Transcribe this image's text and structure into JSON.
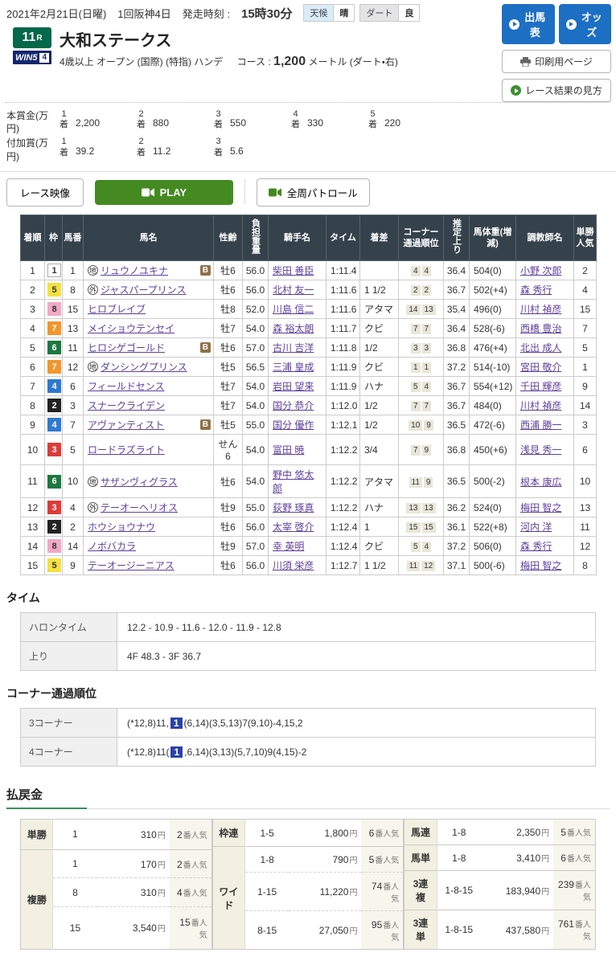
{
  "colors": {
    "button_blue": "#1d6fc4",
    "play_green": "#448a21",
    "race_badge_green": "#04684a",
    "win5_navy": "#13266e",
    "table_header": "#35424b",
    "link_purple": "#5f3e9c",
    "highlight_blue": "#2c41a7",
    "payout_green_bar": "#3a9058",
    "frames": {
      "1": {
        "bg": "#ffffff",
        "fg": "#333333",
        "bd": "#aaaaaa"
      },
      "2": {
        "bg": "#222222",
        "fg": "#ffffff"
      },
      "3": {
        "bg": "#dd3b3b",
        "fg": "#ffffff"
      },
      "4": {
        "bg": "#2e79cf",
        "fg": "#ffffff"
      },
      "5": {
        "bg": "#f2e140",
        "fg": "#333333"
      },
      "6": {
        "bg": "#1c7841",
        "fg": "#ffffff"
      },
      "7": {
        "bg": "#f1962c",
        "fg": "#ffffff"
      },
      "8": {
        "bg": "#f0a9c2",
        "fg": "#333333"
      }
    }
  },
  "topbar": {
    "date": "2021年2月21日(日曜)",
    "meeting": "1回阪神4日",
    "start_label": "発走時刻 :",
    "start_time": "15時30分",
    "weather_label": "天候",
    "weather_value": "晴",
    "track_label": "ダート",
    "track_condition": "良",
    "entry_button": "出馬表",
    "odds_button": "オッズ",
    "print_button": "印刷用ページ",
    "guide_button": "レース結果の見方"
  },
  "race": {
    "number": "11",
    "number_unit": "R",
    "win5_label": "WIN5",
    "win5_number": "4",
    "title": "大和ステークス",
    "conditions": "4歳以上 オープン (国際) (特指) ハンデ",
    "course_label": "コース :",
    "course_distance": "1,200",
    "course_detail": "メートル (ダート・右)"
  },
  "prize": {
    "main_label": "本賞金(万円)",
    "bonus_label": "付加賞(万円)",
    "rank_suffix": "着",
    "main": [
      {
        "rank": "1",
        "amount": "2,200"
      },
      {
        "rank": "2",
        "amount": "880"
      },
      {
        "rank": "3",
        "amount": "550"
      },
      {
        "rank": "4",
        "amount": "330"
      },
      {
        "rank": "5",
        "amount": "220"
      }
    ],
    "bonus": [
      {
        "rank": "1",
        "amount": "39.2"
      },
      {
        "rank": "2",
        "amount": "11.2"
      },
      {
        "rank": "3",
        "amount": "5.6"
      }
    ]
  },
  "video": {
    "race_video": "レース映像",
    "play": "PLAY",
    "patrol": "全周パトロール"
  },
  "results": {
    "blinker_label": "B",
    "columns": [
      "着順",
      "枠",
      "馬番",
      "馬名",
      "性齢",
      "負担重量",
      "騎手名",
      "タイム",
      "着差",
      "コーナー通過順位",
      "推定上り",
      "馬体重(増減)",
      "調教師名",
      "単勝人気"
    ],
    "rows": [
      {
        "pos": "1",
        "frame": "1",
        "num": "1",
        "mark": "地",
        "blinker": true,
        "name": "リュウノユキナ",
        "sex_age": "牡6",
        "impost": "56.0",
        "jockey": "柴田 善臣",
        "time": "1:11.4",
        "margin": "",
        "corners": [
          "4",
          "4"
        ],
        "last3f": "36.4",
        "weight": "504(0)",
        "trainer": "小野 次郎",
        "pop": "2"
      },
      {
        "pos": "2",
        "frame": "5",
        "num": "8",
        "mark": "外",
        "blinker": false,
        "name": "ジャスパープリンス",
        "sex_age": "牡6",
        "impost": "56.0",
        "jockey": "北村 友一",
        "time": "1:11.6",
        "margin": "1 1/2",
        "corners": [
          "2",
          "2"
        ],
        "last3f": "36.7",
        "weight": "502(+4)",
        "trainer": "森 秀行",
        "pop": "4"
      },
      {
        "pos": "3",
        "frame": "8",
        "num": "15",
        "mark": "",
        "blinker": false,
        "name": "ヒロブレイブ",
        "sex_age": "牡8",
        "impost": "52.0",
        "jockey": "川島 信二",
        "time": "1:11.6",
        "margin": "アタマ",
        "corners": [
          "14",
          "13"
        ],
        "last3f": "35.4",
        "weight": "496(0)",
        "trainer": "川村 禎彦",
        "pop": "15"
      },
      {
        "pos": "4",
        "frame": "7",
        "num": "13",
        "mark": "",
        "blinker": false,
        "name": "メイショウテンセイ",
        "sex_age": "牡7",
        "impost": "54.0",
        "jockey": "森 裕太朗",
        "time": "1:11.7",
        "margin": "クビ",
        "corners": [
          "7",
          "7"
        ],
        "last3f": "36.4",
        "weight": "528(-6)",
        "trainer": "西橋 豊治",
        "pop": "7"
      },
      {
        "pos": "5",
        "frame": "6",
        "num": "11",
        "mark": "",
        "blinker": true,
        "name": "ヒロシゲゴールド",
        "sex_age": "牡6",
        "impost": "57.0",
        "jockey": "古川 吉洋",
        "time": "1:11.8",
        "margin": "1/2",
        "corners": [
          "3",
          "3"
        ],
        "last3f": "36.8",
        "weight": "476(+4)",
        "trainer": "北出 成人",
        "pop": "5"
      },
      {
        "pos": "6",
        "frame": "7",
        "num": "12",
        "mark": "地",
        "blinker": false,
        "name": "ダンシングプリンス",
        "sex_age": "牡5",
        "impost": "56.5",
        "jockey": "三浦 皇成",
        "time": "1:11.9",
        "margin": "クビ",
        "corners": [
          "1",
          "1"
        ],
        "last3f": "37.2",
        "weight": "514(-10)",
        "trainer": "宮田 敬介",
        "pop": "1"
      },
      {
        "pos": "7",
        "frame": "4",
        "num": "6",
        "mark": "",
        "blinker": false,
        "name": "フィールドセンス",
        "sex_age": "牡7",
        "impost": "54.0",
        "jockey": "岩田 望来",
        "time": "1:11.9",
        "margin": "ハナ",
        "corners": [
          "5",
          "4"
        ],
        "last3f": "36.7",
        "weight": "554(+12)",
        "trainer": "千田 輝彦",
        "pop": "9"
      },
      {
        "pos": "8",
        "frame": "2",
        "num": "3",
        "mark": "",
        "blinker": false,
        "name": "スナークライデン",
        "sex_age": "牡7",
        "impost": "54.0",
        "jockey": "国分 恭介",
        "time": "1:12.0",
        "margin": "1/2",
        "corners": [
          "7",
          "7"
        ],
        "last3f": "36.7",
        "weight": "484(0)",
        "trainer": "川村 禎彦",
        "pop": "14"
      },
      {
        "pos": "9",
        "frame": "4",
        "num": "7",
        "mark": "",
        "blinker": true,
        "name": "アヴァンティスト",
        "sex_age": "牡5",
        "impost": "55.0",
        "jockey": "国分 優作",
        "time": "1:12.1",
        "margin": "1/2",
        "corners": [
          "10",
          "9"
        ],
        "last3f": "36.5",
        "weight": "472(-6)",
        "trainer": "西浦 勝一",
        "pop": "3"
      },
      {
        "pos": "10",
        "frame": "3",
        "num": "5",
        "mark": "",
        "blinker": false,
        "name": "ロードラズライト",
        "sex_age": "せん6",
        "impost": "54.0",
        "jockey": "富田 暁",
        "time": "1:12.2",
        "margin": "3/4",
        "corners": [
          "7",
          "9"
        ],
        "last3f": "36.8",
        "weight": "450(+6)",
        "trainer": "浅見 秀一",
        "pop": "6"
      },
      {
        "pos": "11",
        "frame": "6",
        "num": "10",
        "mark": "地",
        "blinker": false,
        "name": "サザンヴィグラス",
        "sex_age": "牡6",
        "impost": "54.0",
        "jockey": "野中 悠太郎",
        "time": "1:12.2",
        "margin": "アタマ",
        "corners": [
          "11",
          "9"
        ],
        "last3f": "36.5",
        "weight": "500(-2)",
        "trainer": "根本 康広",
        "pop": "10"
      },
      {
        "pos": "12",
        "frame": "3",
        "num": "4",
        "mark": "外",
        "blinker": false,
        "name": "テーオーヘリオス",
        "sex_age": "牡9",
        "impost": "55.0",
        "jockey": "荻野 琢真",
        "time": "1:12.2",
        "margin": "ハナ",
        "corners": [
          "13",
          "13"
        ],
        "last3f": "36.2",
        "weight": "524(0)",
        "trainer": "梅田 智之",
        "pop": "13"
      },
      {
        "pos": "13",
        "frame": "2",
        "num": "2",
        "mark": "",
        "blinker": false,
        "name": "ホウショウナウ",
        "sex_age": "牡6",
        "impost": "56.0",
        "jockey": "太宰 啓介",
        "time": "1:12.4",
        "margin": "1",
        "corners": [
          "15",
          "15"
        ],
        "last3f": "36.1",
        "weight": "522(+8)",
        "trainer": "河内 洋",
        "pop": "11"
      },
      {
        "pos": "14",
        "frame": "8",
        "num": "14",
        "mark": "",
        "blinker": false,
        "name": "ノボバカラ",
        "sex_age": "牡9",
        "impost": "57.0",
        "jockey": "幸 英明",
        "time": "1:12.4",
        "margin": "クビ",
        "corners": [
          "5",
          "4"
        ],
        "last3f": "37.2",
        "weight": "506(0)",
        "trainer": "森 秀行",
        "pop": "12"
      },
      {
        "pos": "15",
        "frame": "5",
        "num": "9",
        "mark": "",
        "blinker": false,
        "name": "テーオージーニアス",
        "sex_age": "牡6",
        "impost": "56.0",
        "jockey": "川須 栄彦",
        "time": "1:12.7",
        "margin": "1 1/2",
        "corners": [
          "11",
          "12"
        ],
        "last3f": "37.1",
        "weight": "500(-6)",
        "trainer": "梅田 智之",
        "pop": "8"
      }
    ]
  },
  "time_section": {
    "title": "タイム",
    "rows": [
      {
        "label": "ハロンタイム",
        "value": "12.2 - 10.9 - 11.6 - 12.0 - 11.9 - 12.8"
      },
      {
        "label": "上り",
        "value": "4F 48.3 - 3F 36.7"
      }
    ]
  },
  "corner_section": {
    "title": "コーナー通過順位",
    "rows": [
      {
        "label": "3コーナー",
        "before": "(*12,8)11,",
        "highlight": "1",
        "after": "(6,14)(3,5,13)7(9,10)-4,15,2"
      },
      {
        "label": "4コーナー",
        "before": "(*12,8)11(",
        "highlight": "1",
        "after": ",6,14)(3,13)(5,7,10)9(4,15)-2"
      }
    ]
  },
  "payout": {
    "title": "払戻金",
    "yen": "円",
    "pop_suffix": "番人気",
    "groups": [
      [
        {
          "type": "単勝",
          "rows": [
            {
              "combo": "1",
              "amount": "310",
              "pop": "2"
            }
          ]
        },
        {
          "type": "複勝",
          "rows": [
            {
              "combo": "1",
              "amount": "170",
              "pop": "2"
            },
            {
              "combo": "8",
              "amount": "310",
              "pop": "4"
            },
            {
              "combo": "15",
              "amount": "3,540",
              "pop": "15"
            }
          ]
        }
      ],
      [
        {
          "type": "枠連",
          "rows": [
            {
              "combo": "1-5",
              "amount": "1,800",
              "pop": "6"
            }
          ]
        },
        {
          "type": "ワイド",
          "rows": [
            {
              "combo": "1-8",
              "amount": "790",
              "pop": "5"
            },
            {
              "combo": "1-15",
              "amount": "11,220",
              "pop": "74"
            },
            {
              "combo": "8-15",
              "amount": "27,050",
              "pop": "95"
            }
          ]
        }
      ],
      [
        {
          "type": "馬連",
          "rows": [
            {
              "combo": "1-8",
              "amount": "2,350",
              "pop": "5"
            }
          ]
        },
        {
          "type": "馬単",
          "rows": [
            {
              "combo": "1-8",
              "amount": "3,410",
              "pop": "6"
            }
          ]
        },
        {
          "type": "3連複",
          "rows": [
            {
              "combo": "1-8-15",
              "amount": "183,940",
              "pop": "239"
            }
          ]
        },
        {
          "type": "3連単",
          "rows": [
            {
              "combo": "1-8-15",
              "amount": "437,580",
              "pop": "761"
            }
          ]
        }
      ]
    ]
  }
}
